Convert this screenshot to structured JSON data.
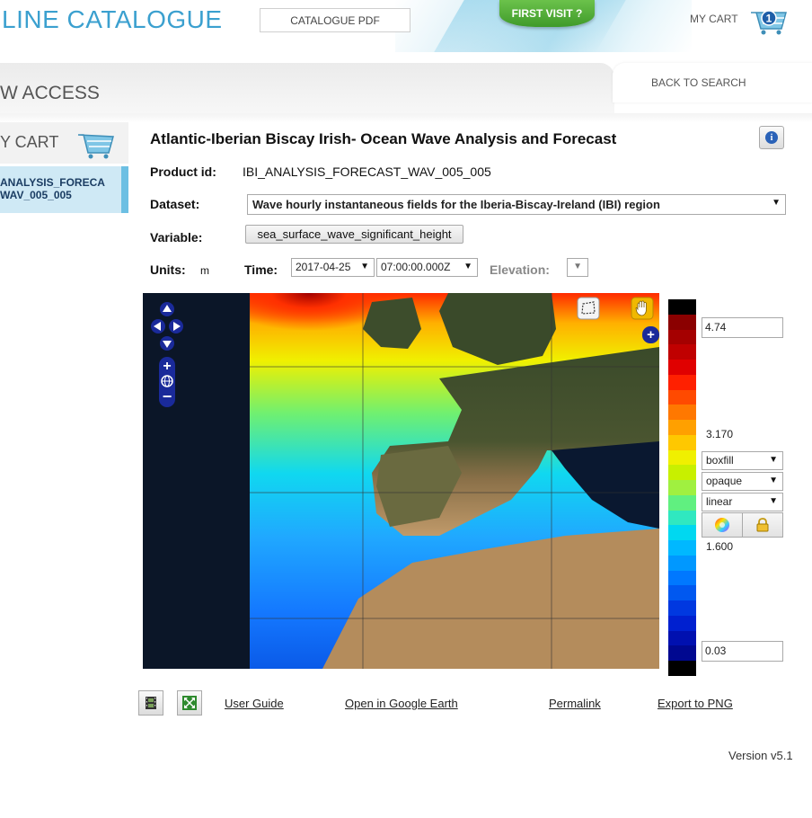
{
  "header": {
    "site_title": "LINE CATALOGUE",
    "pdf_button": "CATALOGUE PDF",
    "first_visit": "FIRST VISIT ?",
    "my_cart": "MY CART",
    "cart_count": "1"
  },
  "subheader": {
    "title": "W ACCESS",
    "back_link": "BACK TO SEARCH"
  },
  "sidebar": {
    "cart_label": "Y CART",
    "item_line1": "ANALYSIS_FORECA",
    "item_line2": "WAV_005_005"
  },
  "product": {
    "title": "Atlantic-Iberian Biscay Irish- Ocean Wave Analysis and Forecast",
    "id_label": "Product id:",
    "id_value": "IBI_ANALYSIS_FORECAST_WAV_005_005",
    "dataset_label": "Dataset:",
    "dataset_value": "Wave hourly instantaneous fields for the Iberia-Biscay-Ireland (IBI) region",
    "variable_label": "Variable:",
    "variable_value": "sea_surface_wave_significant_height",
    "units_label": "Units:",
    "units_value": "m",
    "time_label": "Time:",
    "date_value": "2017-04-25",
    "time_value": "07:00:00.000Z",
    "elevation_label": "Elevation:"
  },
  "legend": {
    "max": "4.74",
    "upper_mid": "3.170",
    "lower_mid": "1.600",
    "min": "0.03",
    "style": "boxfill",
    "opacity": "opaque",
    "scale": "linear",
    "colors": [
      "#000000",
      "#8b0000",
      "#a50000",
      "#c00000",
      "#e00000",
      "#ff2000",
      "#ff4a00",
      "#ff7800",
      "#ffa000",
      "#ffc800",
      "#f0f000",
      "#c8f000",
      "#a0f040",
      "#60f080",
      "#30e8c0",
      "#00d8f0",
      "#00b8ff",
      "#0098ff",
      "#0078ff",
      "#0058f0",
      "#0038e0",
      "#0020d0",
      "#0010b0",
      "#000890",
      "#000000"
    ]
  },
  "footer": {
    "user_guide": "User Guide",
    "google_earth": "Open in Google Earth",
    "permalink": "Permalink",
    "export_png": "Export to PNG",
    "version": "Version v5.1"
  }
}
